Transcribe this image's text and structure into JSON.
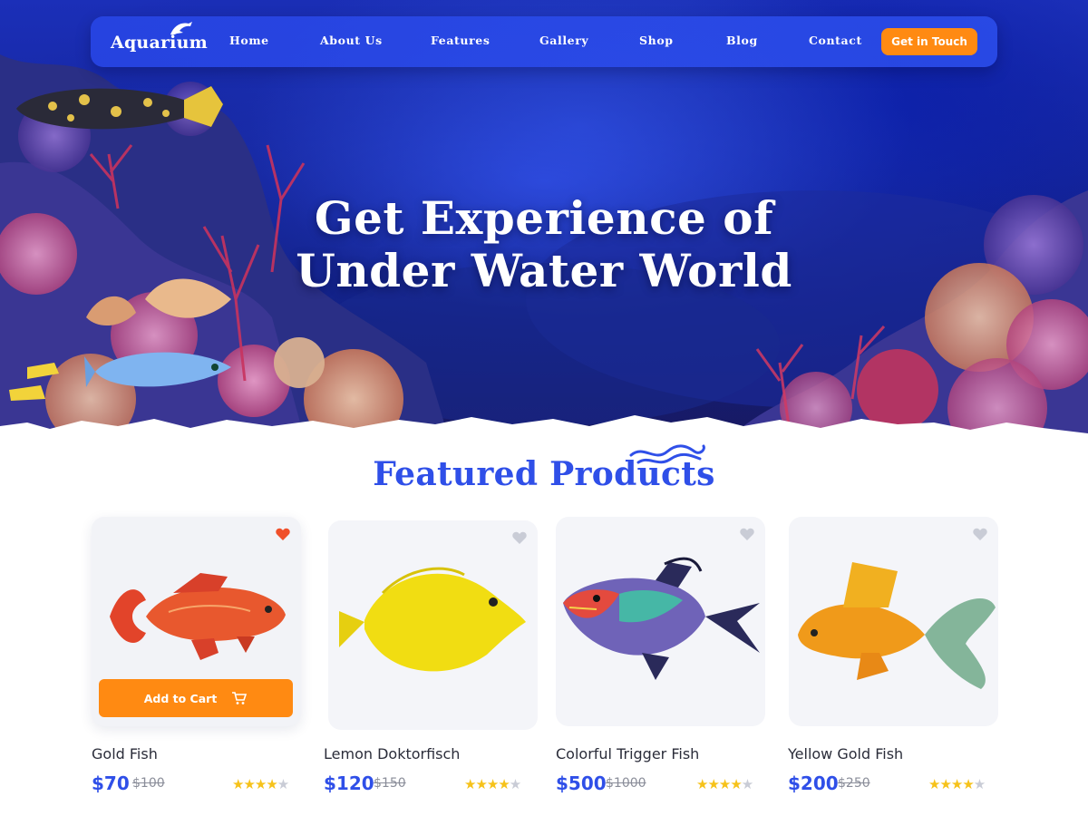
{
  "brand": {
    "logo_text": "Aquarium"
  },
  "nav": {
    "items": [
      "Home",
      "About Us",
      "Features",
      "Gallery",
      "Shop",
      "Blog",
      "Contact"
    ],
    "cta_label": "Get in Touch"
  },
  "hero": {
    "title_line1": "Get Experience of",
    "title_line2": "Under Water World"
  },
  "featured": {
    "title": "Featured Products",
    "add_to_cart_label": "Add to Cart",
    "products": [
      {
        "name": "Gold Fish",
        "price": "$70",
        "old_price": "$100",
        "rating": 4.5,
        "favorited": true
      },
      {
        "name": "Lemon Doktorfisch",
        "price": "$120",
        "old_price": "$150",
        "rating": 4.5,
        "favorited": false
      },
      {
        "name": "Colorful Trigger Fish",
        "price": "$500",
        "old_price": "$1000",
        "rating": 4.5,
        "favorited": false
      },
      {
        "name": "Yellow Gold Fish",
        "price": "$200",
        "old_price": "$250",
        "rating": 4.5,
        "favorited": false
      }
    ]
  },
  "colors": {
    "accent_blue": "#2f4fe8",
    "accent_orange": "#ff8a12",
    "heart_active": "#f0502a",
    "heart_inactive": "#c9ccd6",
    "star": "#f6c21a"
  },
  "icons": {
    "logo": "dolphin-icon",
    "cart": "cart-icon",
    "favorite": "heart-icon",
    "rating": "star-icon",
    "title_decoration": "waves-icon"
  }
}
